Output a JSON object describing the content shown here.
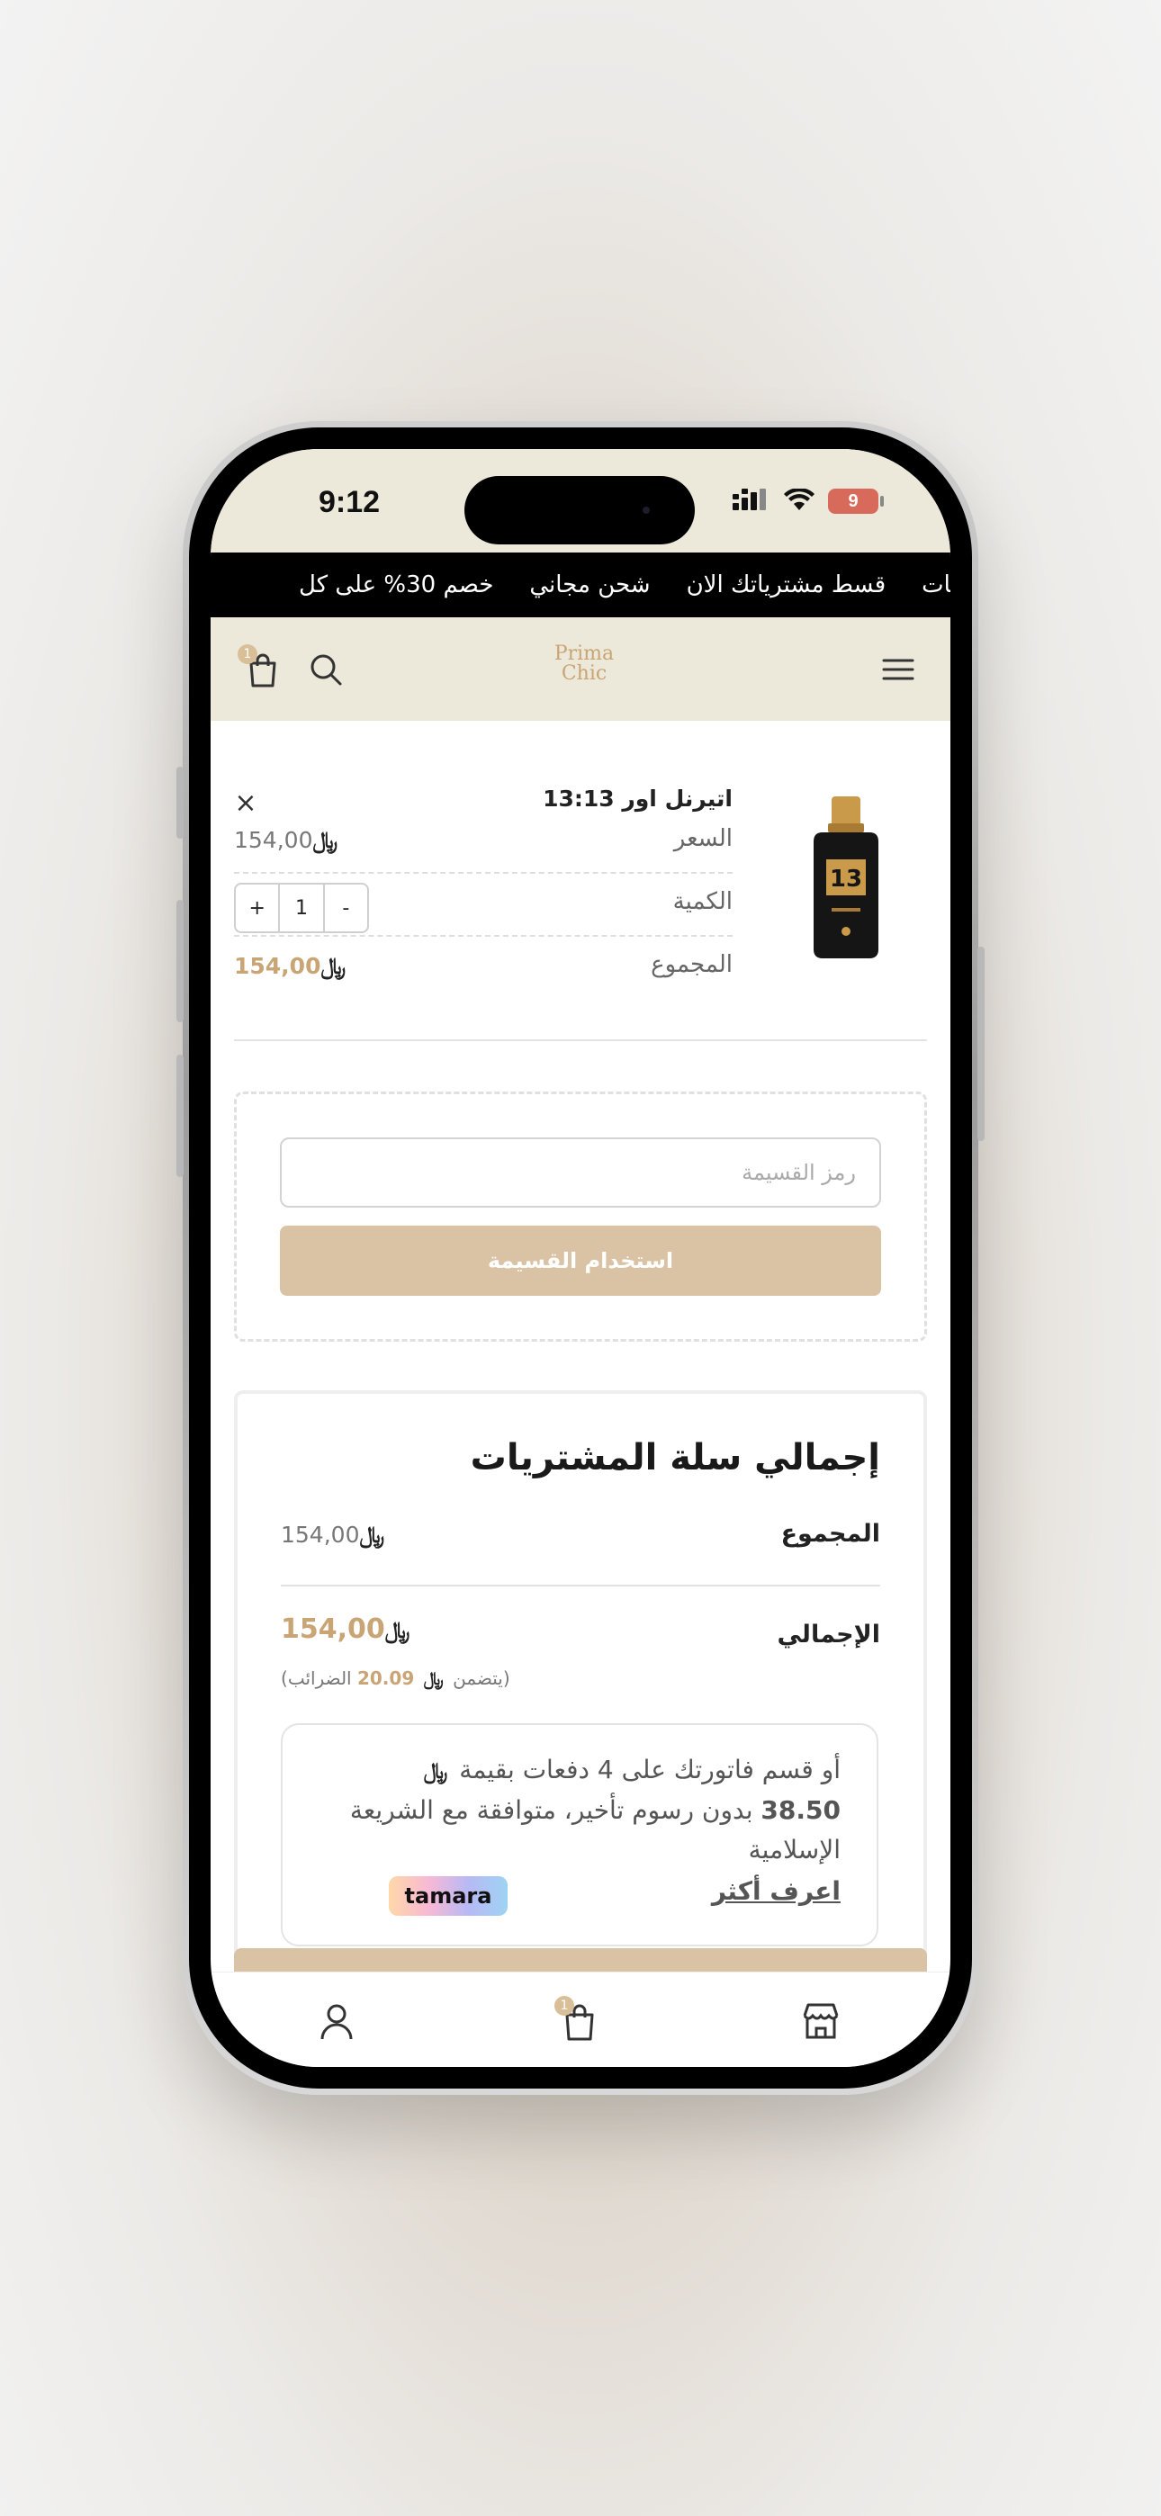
{
  "status_bar": {
    "time": "9:12",
    "battery": "9"
  },
  "promo_bar": {
    "items": [
      "خصم 30% على كل",
      "شحن مجاني",
      "قسط مشترياتك الان",
      "لمنتجات"
    ]
  },
  "header": {
    "logo_line1": "Prima",
    "logo_line2": "Chic",
    "cart_count": "1"
  },
  "cart_item": {
    "title": "اتيرنل اور 13:13",
    "price_label": "السعر",
    "price_value": "154,00",
    "quantity_label": "الكمية",
    "quantity_value": "1",
    "qty_plus": "+",
    "qty_minus": "-",
    "total_label": "المجموع",
    "total_value": "154,00",
    "remove": "×"
  },
  "coupon": {
    "placeholder": "رمز القسيمة",
    "button_label": "استخدام القسيمة"
  },
  "summary": {
    "title": "إجمالي سلة المشتريات",
    "subtotal_label": "المجموع",
    "subtotal_value": "154,00",
    "total_label": "الإجمالي",
    "total_value": "154,00",
    "tax_prefix": "(يتضمن",
    "tax_amount": "20.09",
    "tax_suffix": "الضرائب)"
  },
  "tamara": {
    "text_part1": "أو قسم فاتورتك على 4 دفعات بقيمة",
    "amount": "38.50",
    "text_part2": "بدون رسوم تأخير، متوافقة مع الشريعة الإسلامية",
    "learn_more": "اعرف أكثر",
    "brand": "tamara"
  },
  "currency_symbol": "﷼",
  "bottom_nav": {
    "cart_count": "1"
  },
  "colors": {
    "accent": "#c9a575",
    "header_bg": "#ece8da",
    "button_bg": "#d9c3a4"
  }
}
